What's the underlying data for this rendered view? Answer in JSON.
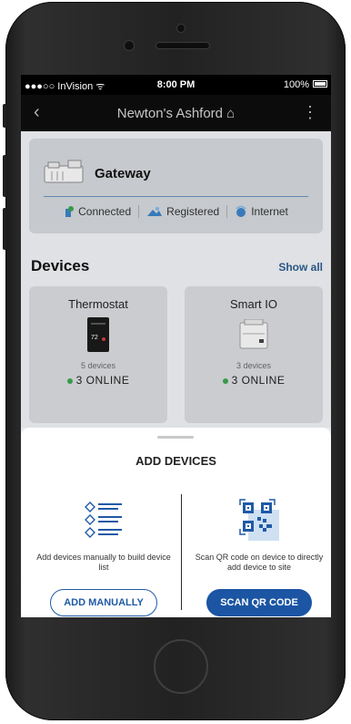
{
  "status_bar": {
    "carrier": "●●●○○ InVision ᯤ",
    "time": "8:00 PM",
    "battery": "100%"
  },
  "nav": {
    "back": "‹",
    "title": "Newton's Ashford ⌂",
    "more": "⋮"
  },
  "gateway": {
    "title": "Gateway",
    "statuses": [
      {
        "label": "Connected"
      },
      {
        "label": "Registered"
      },
      {
        "label": "Internet"
      }
    ]
  },
  "devices": {
    "title": "Devices",
    "show_all": "Show all",
    "cards": [
      {
        "name": "Thermostat",
        "count": "5 devices",
        "online": "3 ONLINE"
      },
      {
        "name": "Smart IO",
        "count": "3 devices",
        "online": "3 ONLINE"
      }
    ]
  },
  "sheet": {
    "title": "ADD DEVICES",
    "manual_text": "Add devices manually to build device list",
    "manual_button": "ADD MANUALLY",
    "qr_text": "Scan QR code on device to directly add device to site",
    "qr_button": "SCAN QR CODE"
  },
  "colors": {
    "accent": "#1b55a3",
    "online": "#3aa04d"
  }
}
